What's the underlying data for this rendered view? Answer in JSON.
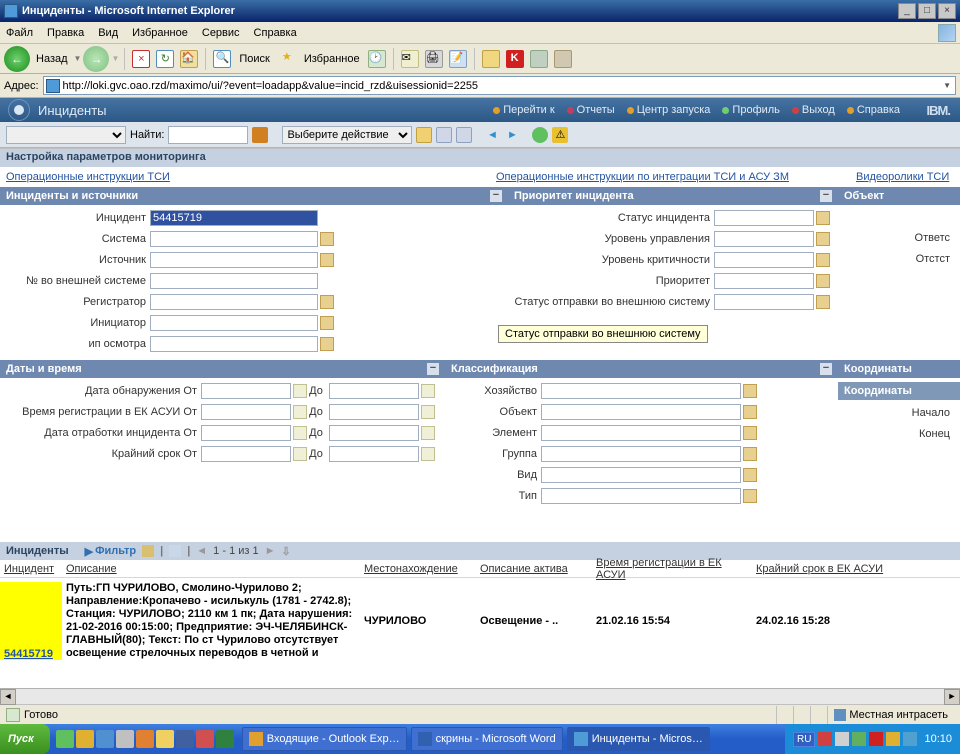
{
  "ie": {
    "title": "Инциденты - Microsoft Internet Explorer",
    "menu": [
      "Файл",
      "Правка",
      "Вид",
      "Избранное",
      "Сервис",
      "Справка"
    ],
    "back": "Назад",
    "search": "Поиск",
    "favorites": "Избранное",
    "addr_label": "Адрес:",
    "url": "http://loki.gvc.oao.rzd/maximo/ui/?event=loadapp&value=incid_rzd&uisessionid=2255",
    "status_left": "Готово",
    "status_right": "Местная интрасеть"
  },
  "maximo": {
    "title": "Инциденты",
    "nav": {
      "goto": "Перейти к",
      "reports": "Отчеты",
      "launch": "Центр запуска",
      "profile": "Профиль",
      "exit": "Выход",
      "help": "Справка"
    },
    "ibm": "IBM.",
    "find_label": "Найти:",
    "action_label": "Выберите действие",
    "section1": "Настройка параметров мониторинга",
    "links": {
      "tsi": "Операционные инструкции ТСИ",
      "integration": "Операционные инструкции по интеграции ТСИ и АСУ ЗМ",
      "video": "Видеоролики ТСИ"
    },
    "panels": {
      "left": "Инциденты и источники",
      "mid": "Приоритет инцидента",
      "right": "Объект",
      "dates": "Даты и время",
      "class": "Классификация",
      "coords": "Координаты",
      "coords_sub": "Координаты"
    },
    "fields": {
      "incident": "Инцидент",
      "system": "Система",
      "source": "Источник",
      "extnum": "№ во внешней системе",
      "registrar": "Регистратор",
      "initiator": "Инициатор",
      "ipinsp": "ип осмотра",
      "status": "Статус инцидента",
      "mgmt": "Уровень управления",
      "crit": "Уровень критичности",
      "priority": "Приоритет",
      "sendstatus": "Статус отправки во внешнюю систему",
      "resp": "Ответс",
      "respst": "Отстст",
      "detect_from": "Дата обнаружения От",
      "reg_from": "Время регистрации в ЕК АСУИ От",
      "proc_from": "Дата отработки инцидента От",
      "deadline_from": "Крайний срок От",
      "to": "До",
      "economy": "Хозяйство",
      "object": "Объект",
      "element": "Элемент",
      "group": "Группа",
      "kind": "Вид",
      "type": "Тип",
      "start": "Начало",
      "end": "Конец"
    },
    "incident_value": "54415719",
    "tooltip": "Статус отправки во внешнюю систему",
    "grid": {
      "title": "Инциденты",
      "filter": "Фильтр",
      "paging": "1 - 1 из 1",
      "cols": {
        "incident": "Инцидент",
        "desc": "Описание",
        "loc": "Местонахождение",
        "asset": "Описание актива",
        "regtime": "Время регистрации в ЕК АСУИ",
        "deadline": "Крайний срок в ЕК АСУИ"
      },
      "row": {
        "incident": "54415719",
        "desc": "Путь:ГП ЧУРИЛОВО, Смолино-Чурилово 2; Направление:Кропачево - исилькуль (1781 - 2742.8); Станция: ЧУРИЛОВО; 2110 км 1 пк; Дата нарушения: 21-02-2016 00:15:00; Предприятие: ЭЧ-ЧЕЛЯБИНСК-ГЛАВНЫЙ(80); Текст: По ст Чурилово отсутствует освещение стрелочных переводов в четной и",
        "loc": "ЧУРИЛОВО",
        "asset": "Освещение - ..",
        "regtime": "21.02.16 15:54",
        "deadline": "24.02.16 15:28"
      }
    }
  },
  "taskbar": {
    "start": "Пуск",
    "tasks": [
      "Входящие - Outlook Exp…",
      "скрины - Microsoft Word",
      "Инциденты - Micros…"
    ],
    "lang": "RU",
    "clock": "10:10"
  }
}
